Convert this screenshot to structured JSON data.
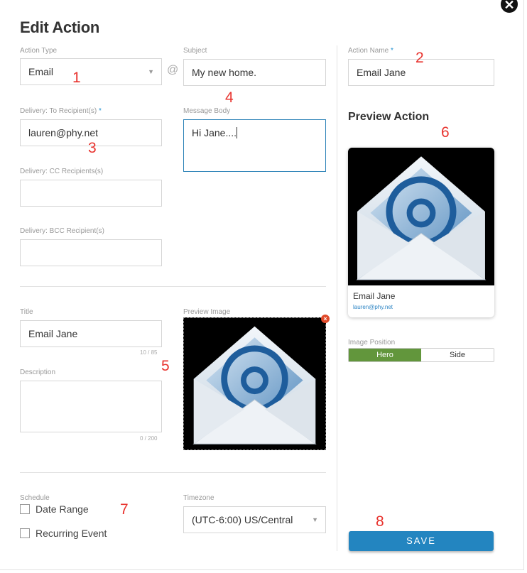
{
  "dialog": {
    "title": "Edit Action",
    "close_glyph": "✕"
  },
  "form": {
    "action_type": {
      "label": "Action Type",
      "value": "Email"
    },
    "subject": {
      "label": "Subject",
      "value": "My new home."
    },
    "action_name": {
      "label": "Action Name",
      "required": "*",
      "value": "Email Jane"
    },
    "to": {
      "label": "Delivery: To Recipient(s)",
      "required": "*",
      "value": "lauren@phy.net"
    },
    "message": {
      "label": "Message Body",
      "value": "Hi Jane...."
    },
    "cc": {
      "label": "Delivery: CC Recipients(s)",
      "value": ""
    },
    "bcc": {
      "label": "Delivery: BCC Recipient(s)",
      "value": ""
    },
    "title": {
      "label": "Title",
      "value": "Email Jane",
      "counter": "10 / 85"
    },
    "description": {
      "label": "Description",
      "value": "",
      "counter": "0 / 200"
    },
    "preview_image": {
      "label": "Preview Image"
    },
    "schedule": {
      "label": "Schedule",
      "date_range": "Date Range",
      "recurring": "Recurring Event"
    },
    "timezone": {
      "label": "Timezone",
      "value": "(UTC-6:00) US/Central"
    }
  },
  "preview": {
    "heading": "Preview Action",
    "card_title": "Email Jane",
    "card_subtitle": "lauren@phy.net",
    "image_position_label": "Image Position",
    "options": [
      "Hero",
      "Side"
    ],
    "selected": "Hero"
  },
  "save_label": "SAVE",
  "annotations": [
    "1",
    "2",
    "3",
    "4",
    "5",
    "6",
    "7",
    "8"
  ],
  "colors": {
    "accent": "#2385c0",
    "selected_segment": "#62963c",
    "annotation": "#e8322d",
    "required": "#1e8fd0"
  },
  "icons": [
    "close-icon",
    "chevron-down-icon",
    "at-sign-icon",
    "remove-icon",
    "email-envelope-icon"
  ]
}
